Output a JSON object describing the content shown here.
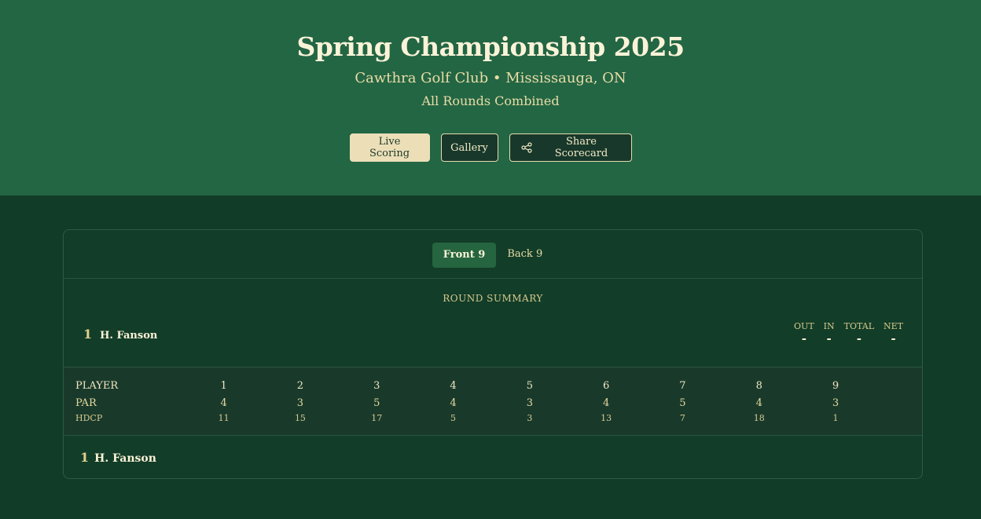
{
  "header": {
    "title": "Spring Championship 2025",
    "venue": "Cawthra Golf Club • Mississauga, ON",
    "round": "All Rounds Combined",
    "buttons": {
      "live_scoring": "Live Scoring",
      "gallery": "Gallery",
      "share": "Share Scorecard"
    }
  },
  "tabs": [
    {
      "label": "Front 9",
      "active": true
    },
    {
      "label": "Back 9",
      "active": false
    }
  ],
  "summary": {
    "label": "ROUND SUMMARY",
    "player": {
      "rank": "1",
      "name": "H. Fanson"
    },
    "stats": [
      {
        "label": "OUT",
        "value": "-"
      },
      {
        "label": "IN",
        "value": "-"
      },
      {
        "label": "TOTAL",
        "value": "-"
      },
      {
        "label": "NET",
        "value": "-"
      }
    ]
  },
  "scorecard": {
    "player_header": "PLAYER",
    "par_label": "PAR",
    "hdcp_label": "HDCP",
    "holes": [
      "1",
      "2",
      "3",
      "4",
      "5",
      "6",
      "7",
      "8",
      "9"
    ],
    "par": [
      "4",
      "3",
      "5",
      "4",
      "3",
      "4",
      "5",
      "4",
      "3"
    ],
    "hdcp": [
      "11",
      "15",
      "17",
      "5",
      "3",
      "13",
      "7",
      "18",
      "1"
    ],
    "players": [
      {
        "rank": "1",
        "name": "H. Fanson"
      }
    ]
  },
  "colors": {
    "hero_bg": "#236644",
    "page_bg": "#113c27",
    "accent": "#ecdfb8"
  }
}
